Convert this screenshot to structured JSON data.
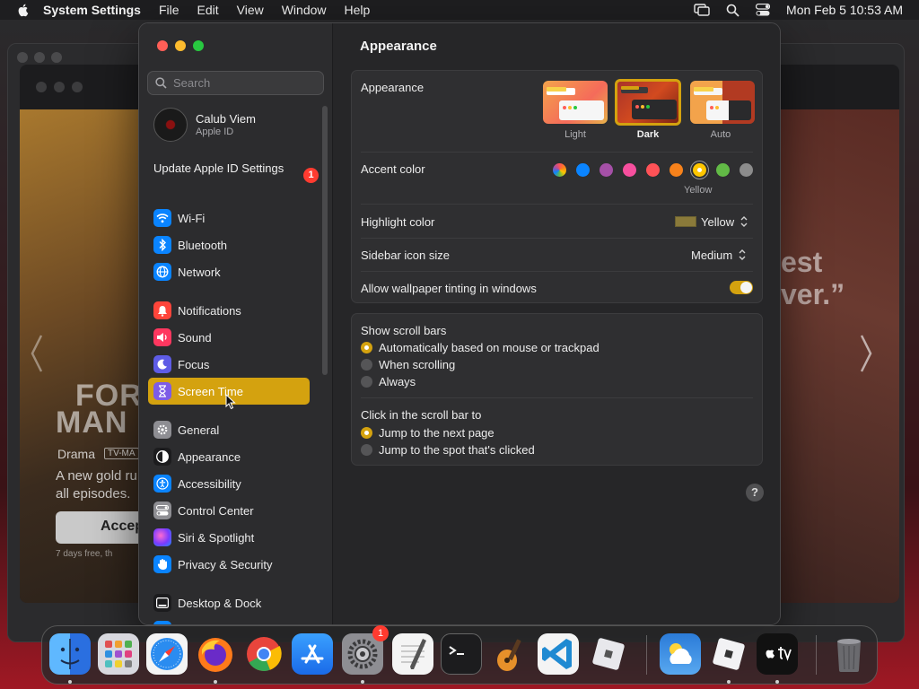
{
  "menubar": {
    "app_name": "System Settings",
    "items": [
      "File",
      "Edit",
      "View",
      "Window",
      "Help"
    ],
    "clock": "Mon Feb 5  10:53 AM"
  },
  "sidebar": {
    "search_placeholder": "Search",
    "user": {
      "name": "Calub Viem",
      "subtitle": "Apple ID"
    },
    "update": {
      "label": "Update Apple ID Settings",
      "badge": "1"
    },
    "items": [
      {
        "label": "Wi-Fi",
        "icon": "wifi-icon",
        "color": "#0a84ff"
      },
      {
        "label": "Bluetooth",
        "icon": "bluetooth-icon",
        "color": "#0a84ff"
      },
      {
        "label": "Network",
        "icon": "globe-icon",
        "color": "#0a84ff"
      },
      {
        "label": "Notifications",
        "icon": "bell-icon",
        "color": "#ff453a"
      },
      {
        "label": "Sound",
        "icon": "speaker-icon",
        "color": "#ff375f"
      },
      {
        "label": "Focus",
        "icon": "moon-icon",
        "color": "#5e5ce6"
      },
      {
        "label": "Screen Time",
        "icon": "hourglass-icon",
        "color": "#7d5ce6"
      },
      {
        "label": "General",
        "icon": "gear-icon",
        "color": "#8e8e93"
      },
      {
        "label": "Appearance",
        "icon": "appearance-icon",
        "color": "#1c1c1e"
      },
      {
        "label": "Accessibility",
        "icon": "accessibility-icon",
        "color": "#0a84ff"
      },
      {
        "label": "Control Center",
        "icon": "control-center-icon",
        "color": "#8e8e93"
      },
      {
        "label": "Siri & Spotlight",
        "icon": "siri-icon",
        "color": "#bf5af2"
      },
      {
        "label": "Privacy & Security",
        "icon": "hand-icon",
        "color": "#0a84ff"
      },
      {
        "label": "Desktop & Dock",
        "icon": "dock-icon",
        "color": "#1c1c1e"
      }
    ],
    "active_item": "Screen Time"
  },
  "content": {
    "title": "Appearance",
    "appearance": {
      "label": "Appearance",
      "options": [
        {
          "label": "Light",
          "selected": false
        },
        {
          "label": "Dark",
          "selected": true
        },
        {
          "label": "Auto",
          "selected": false
        }
      ]
    },
    "accent": {
      "label": "Accent color",
      "selected_name": "Yellow",
      "colors": [
        "multicolor",
        "#0a84ff",
        "#a550a7",
        "#f74f9e",
        "#ff5257",
        "#f7821b",
        "#ffc600",
        "#62ba46",
        "#8c8c8c"
      ]
    },
    "highlight": {
      "label": "Highlight color",
      "value": "Yellow",
      "swatch": "#8a7a3a"
    },
    "sidebar_icon_size": {
      "label": "Sidebar icon size",
      "value": "Medium"
    },
    "wallpaper_tinting": {
      "label": "Allow wallpaper tinting in windows",
      "enabled": true
    },
    "scroll_bars": {
      "label": "Show scroll bars",
      "options": [
        {
          "label": "Automatically based on mouse or trackpad",
          "selected": true
        },
        {
          "label": "When scrolling",
          "selected": false
        },
        {
          "label": "Always",
          "selected": false
        }
      ]
    },
    "click_scroll": {
      "label": "Click in the scroll bar to",
      "options": [
        {
          "label": "Jump to the next page",
          "selected": true
        },
        {
          "label": "Jump to the spot that's clicked",
          "selected": false
        }
      ]
    },
    "help": "?"
  },
  "background_app": {
    "title_top": "FOR",
    "title_bottom": "MAN",
    "genre": "Drama",
    "rating": "TV-MA",
    "desc_1": "A new gold ru",
    "desc_2": "all episodes.",
    "button": "Accep",
    "fineprint": "7 days free, th",
    "quote_1": "est",
    "quote_2": "ver.”"
  },
  "dock": {
    "settings_badge": "1",
    "apps": [
      "finder-icon",
      "launchpad-icon",
      "safari-icon",
      "firefox-icon",
      "chrome-icon",
      "app-store-icon",
      "system-settings-icon",
      "textedit-icon",
      "terminal-icon",
      "garageband-icon",
      "vscode-icon",
      "roblox-icon",
      "weather-icon",
      "roblox-studio-icon",
      "apple-tv-icon",
      "trash-icon"
    ]
  }
}
